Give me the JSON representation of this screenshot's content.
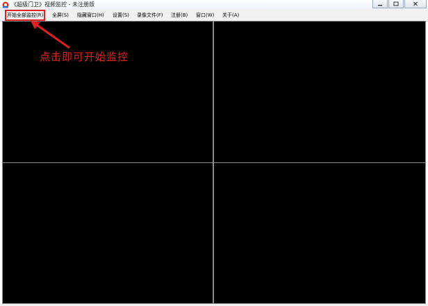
{
  "window": {
    "title": "《超级门卫》视频监控 - 未注册版",
    "icon": "app-logo-icon"
  },
  "menu": [
    {
      "label": "开始全部监控(R)"
    },
    {
      "label": "全屏(S)"
    },
    {
      "label": "隐藏窗口(H)"
    },
    {
      "label": "设置(S)"
    },
    {
      "label": "录像文件(F)"
    },
    {
      "label": "注册(B)"
    },
    {
      "label": "窗口(W)"
    },
    {
      "label": "关于(A)"
    }
  ],
  "annotation": {
    "text": "点击即可开始监控"
  },
  "colors": {
    "highlight": "#e02020",
    "video_bg": "#000000"
  }
}
